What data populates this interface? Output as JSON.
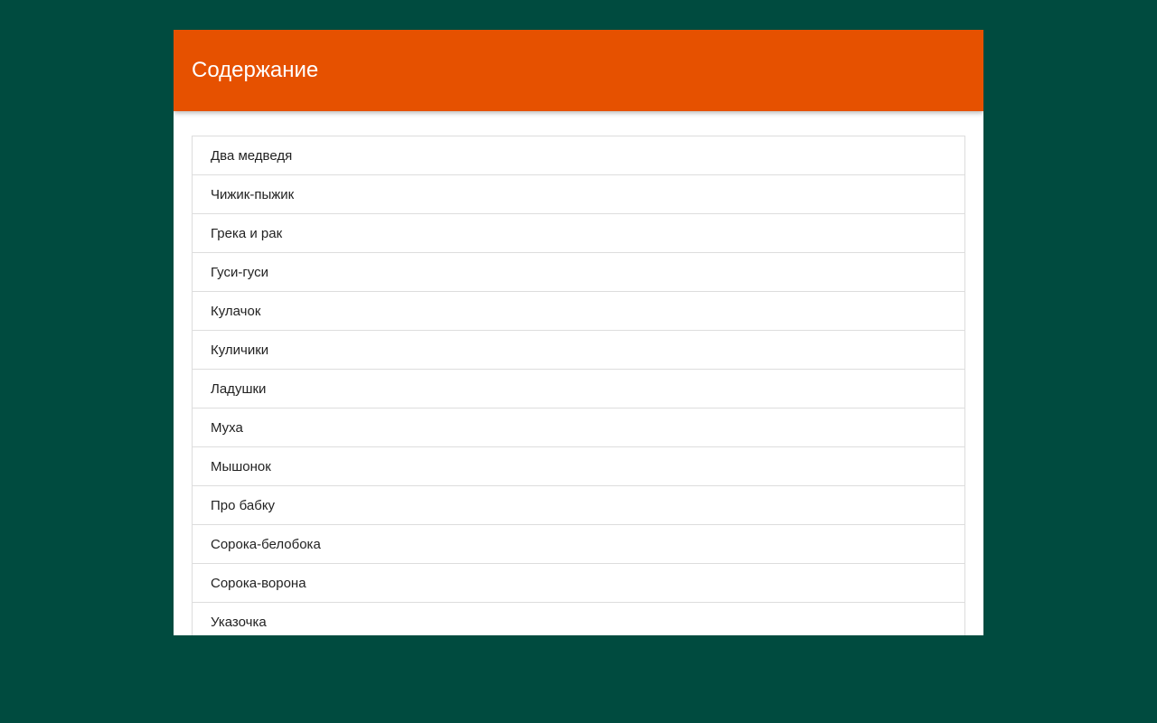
{
  "colors": {
    "background": "#004b3f",
    "header": "#e65100",
    "panel": "#ffffff"
  },
  "header": {
    "title": "Содержание"
  },
  "contents": {
    "items": [
      {
        "label": "Два медведя"
      },
      {
        "label": "Чижик-пыжик"
      },
      {
        "label": "Грека и рак"
      },
      {
        "label": "Гуси-гуси"
      },
      {
        "label": "Кулачок"
      },
      {
        "label": "Куличики"
      },
      {
        "label": "Ладушки"
      },
      {
        "label": "Муха"
      },
      {
        "label": "Мышонок"
      },
      {
        "label": "Про бабку"
      },
      {
        "label": "Сорока-белобока"
      },
      {
        "label": "Сорока-ворона"
      },
      {
        "label": "Указочка"
      }
    ]
  }
}
